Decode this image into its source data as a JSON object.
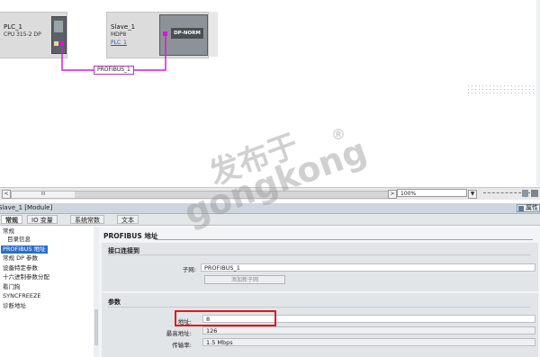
{
  "network": {
    "plc": {
      "name": "PLC_1",
      "type": "CPU 315-2 DP"
    },
    "slave": {
      "name": "Slave_1",
      "type": "MDP8",
      "link": "PLC_1",
      "module_label": "DP-NORM"
    },
    "bus_label": "PROFIBUS_1",
    "colors": {
      "bus": "#d020d0",
      "device": "#dcdcdc"
    }
  },
  "statusbar": {
    "scroll_grip": "III",
    "zoom": "100%",
    "left_arrow": "<",
    "right_arrow": ">",
    "dropdown_arrow": "▼"
  },
  "inspector": {
    "title": "Slave_1 [Module]",
    "properties_label": "属性",
    "tabs": [
      "常规",
      "IO 变量",
      "系统常数",
      "文本"
    ],
    "nav": [
      "常规",
      "目录信息",
      "PROFIBUS 地址",
      "常规 DP 参数",
      "设备特定参数",
      "十六进制参数分配",
      "看门狗",
      "SYNCFREEZE",
      "诊断地址"
    ],
    "nav_selected": 2,
    "page_title": "PROFIBUS 地址",
    "interface_section": "接口连接到",
    "subnet_label": "子网:",
    "subnet_value": "PROFIBUS_1",
    "add_subnet_button": "添加新子网",
    "params_section": "参数",
    "address_label": "地址:",
    "address_value": "8",
    "highest_label": "最高地址:",
    "highest_value": "126",
    "rate_label": "传输率:",
    "rate_value": "1.5 Mbps"
  },
  "watermark": {
    "line1": "发布于",
    "line2": "gongkong",
    "mark": "®"
  }
}
